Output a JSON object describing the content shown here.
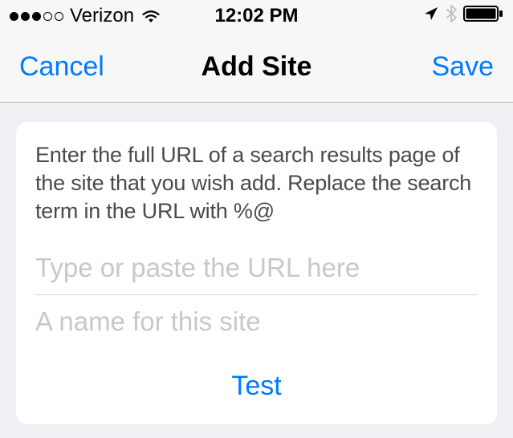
{
  "status_bar": {
    "carrier": "Verizon",
    "time": "12:02 PM"
  },
  "nav": {
    "cancel": "Cancel",
    "title": "Add Site",
    "save": "Save"
  },
  "card": {
    "instructions": "Enter the full URL of a search results page of the site that you wish add. Replace the search term in the URL with %@",
    "url_placeholder": "Type or paste the URL here",
    "name_placeholder": "A name for this site",
    "test_label": "Test"
  }
}
